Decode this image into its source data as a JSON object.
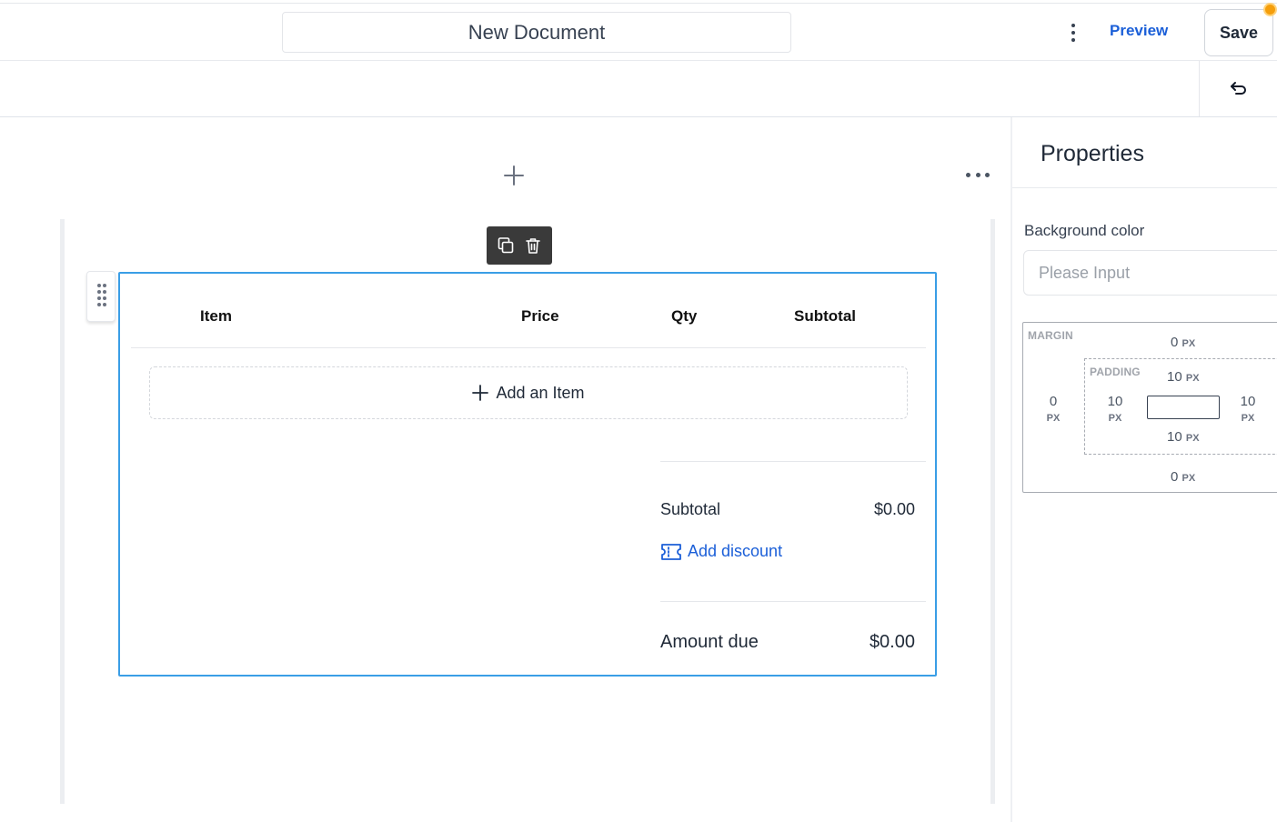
{
  "header": {
    "document_title": "New Document",
    "more_icon": "vertical-dots-icon",
    "preview_label": "Preview",
    "save_label": "Save",
    "unsaved_indicator_color": "#f59e0b"
  },
  "toolbar": {
    "undo_icon": "undo-icon"
  },
  "canvas": {
    "add_block_icon": "plus-icon",
    "more_icon": "horizontal-dots-icon",
    "block_toolbar": {
      "duplicate_icon": "duplicate-icon",
      "delete_icon": "trash-icon"
    },
    "drag_handle_icon": "grip-icon"
  },
  "invoice": {
    "columns": [
      "Item",
      "Price",
      "Qty",
      "Subtotal"
    ],
    "add_item_label": "Add an Item",
    "subtotal_label": "Subtotal",
    "subtotal_value": "$0.00",
    "add_discount_label": "Add discount",
    "discount_icon": "ticket-icon",
    "amount_due_label": "Amount due",
    "amount_due_value": "$0.00",
    "accent_color": "#3a9ee6",
    "link_color": "#1b5fd8"
  },
  "properties": {
    "title": "Properties",
    "background_color_label": "Background color",
    "background_color_placeholder": "Please Input",
    "margin": {
      "label": "MARGIN",
      "top": "0",
      "bottom": "0",
      "left": "0",
      "unit": "PX"
    },
    "padding": {
      "label": "PADDING",
      "top": "10",
      "bottom": "10",
      "left": "10",
      "right": "10",
      "unit": "PX"
    }
  }
}
